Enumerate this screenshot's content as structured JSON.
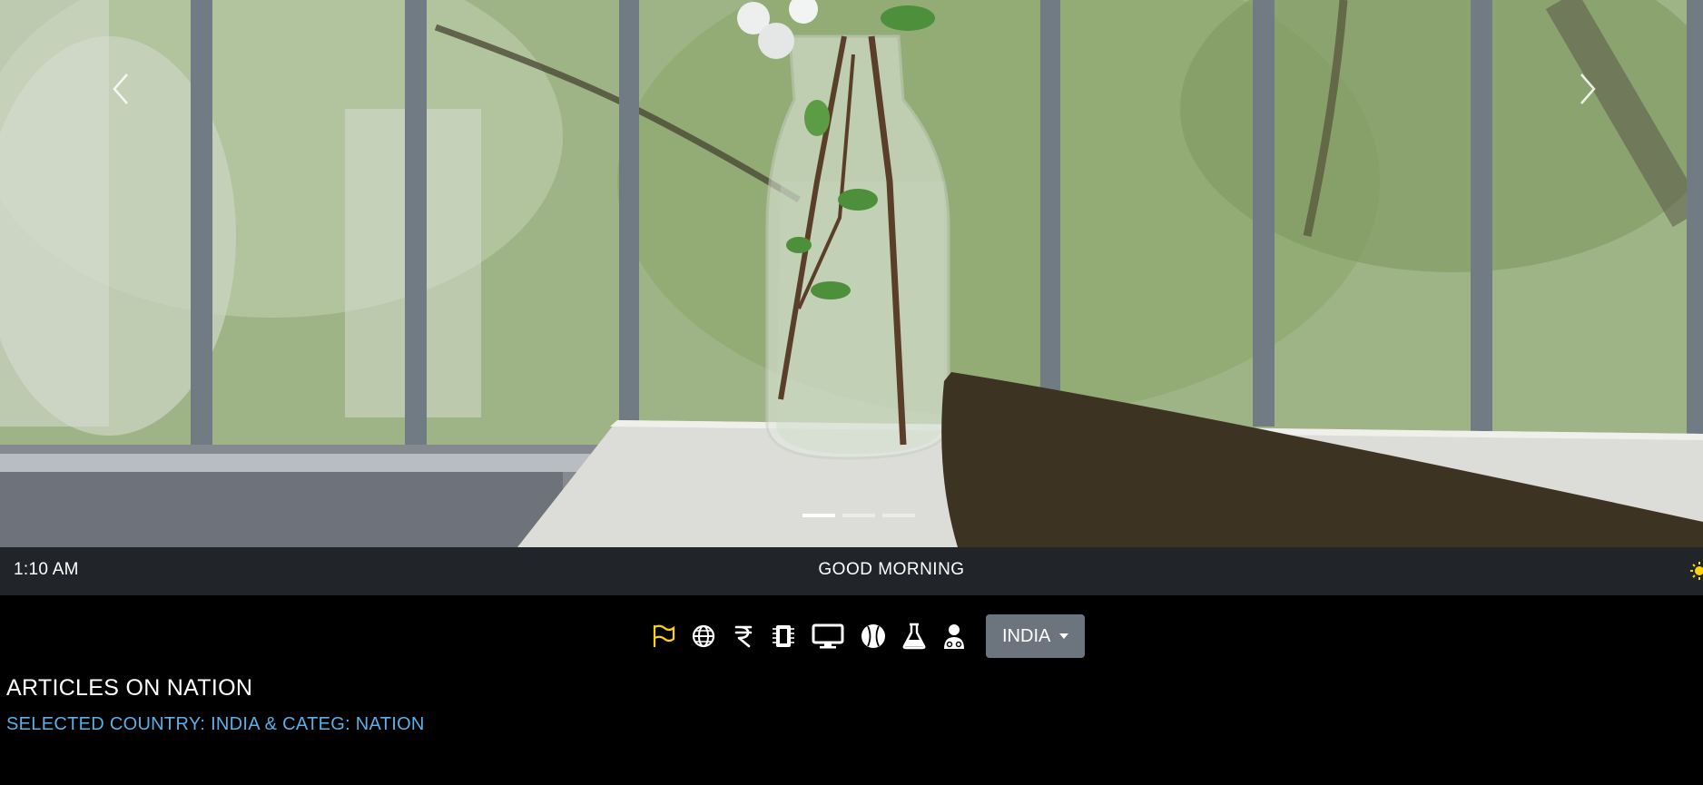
{
  "carousel": {
    "prev_icon": "chevron-left-icon",
    "next_icon": "chevron-right-icon",
    "slides": 3,
    "active_slide": 1
  },
  "infobar": {
    "time": "1:10 AM",
    "greeting": "GOOD MORNING",
    "weather_icon": "sun-icon",
    "weather_color": "#ffd400"
  },
  "categories": {
    "active_color": "#ffd400",
    "icons": [
      "flag-icon",
      "globe-icon",
      "rupee-icon",
      "chip-icon",
      "monitor-icon",
      "baseball-icon",
      "flask-icon",
      "doctor-icon"
    ],
    "country_selected": "INDIA"
  },
  "content": {
    "heading": "ARTICLES ON NATION",
    "subheading": "SELECTED COUNTRY: INDIA & CATEG: NATION",
    "subheading_color": "#5bb0e8"
  }
}
